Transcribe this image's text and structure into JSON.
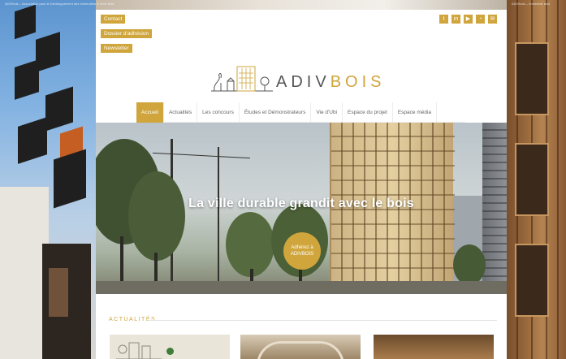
{
  "chrome": {
    "left_title": "ADIVbois – Association pour le Développement des Immeubles à Vivre Bois",
    "right_title": "ADIVbois – Immeuble bois"
  },
  "top_buttons": {
    "contact": "Contact",
    "membership_doc": "Dossier d'adhésion",
    "newsletter": "Newsletter"
  },
  "socials": [
    "twitter-icon",
    "linkedin-icon",
    "youtube-icon",
    "rss-icon",
    "mail-icon"
  ],
  "logo": {
    "adiv": "ADIV",
    "bois": "BOIS"
  },
  "nav": {
    "items": [
      "Accueil",
      "Actualités",
      "Les concours",
      "Études et Démonstrateurs",
      "Vie d'Ubi",
      "Espace du projet",
      "Espace média"
    ],
    "active_index": 0
  },
  "hero": {
    "title_part1": "La ville durable ",
    "title_strong": "grandit",
    "title_part2": " avec le bois",
    "cta": "Adhérez à ADIVBOIS"
  },
  "news": {
    "title": "ACTUALITÉS"
  },
  "colors": {
    "accent": "#cfa53c",
    "text_grey": "#555555"
  }
}
